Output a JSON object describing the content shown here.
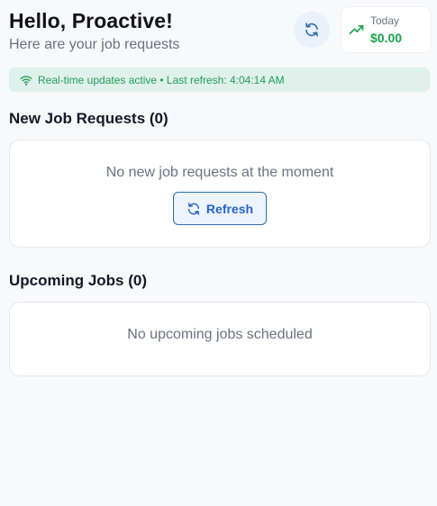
{
  "header": {
    "greeting": "Hello, Proactive!",
    "subtitle": "Here are your job requests",
    "refresh_icon": "refresh-icon",
    "earnings": {
      "label": "Today",
      "value": "$0.00",
      "icon": "trending-up-icon"
    }
  },
  "status": {
    "icon": "wifi-icon",
    "text": "Real-time updates active • Last refresh: 4:04:14 AM"
  },
  "new_requests": {
    "title": "New Job Requests (0)",
    "empty_message": "No new job requests at the moment",
    "refresh_button_label": "Refresh"
  },
  "upcoming": {
    "title": "Upcoming Jobs (0)",
    "empty_message": "No upcoming jobs scheduled"
  },
  "colors": {
    "accent_blue": "#2563c9",
    "success_green": "#16a34a",
    "status_bg": "#dff1ea"
  }
}
